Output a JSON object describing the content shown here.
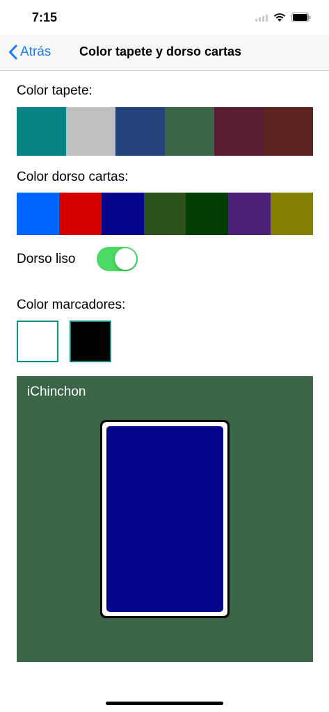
{
  "status_bar": {
    "time": "7:15",
    "icons": [
      "signal-icon",
      "wifi-icon",
      "battery-icon"
    ]
  },
  "navbar": {
    "back_label": "Atrás",
    "title": "Color tapete y dorso cartas"
  },
  "table_color": {
    "label": "Color tapete:",
    "colors": [
      "#088486",
      "#bfbfbf",
      "#23437a",
      "#3a6647",
      "#5a1e34",
      "#5f2422"
    ]
  },
  "card_back_color": {
    "label": "Color dorso cartas:",
    "colors": [
      "#0066ff",
      "#d40000",
      "#07058b",
      "#2c521c",
      "#003f01",
      "#4b2078",
      "#848000"
    ]
  },
  "plain_back": {
    "label": "Dorso liso",
    "on": true
  },
  "markers": {
    "label": "Color marcadores:",
    "colors": [
      "#ffffff",
      "#000000"
    ],
    "border_color": "#128a87"
  },
  "preview": {
    "label": "iChinchon",
    "table_color": "#3a6647",
    "card_back_color": "#07058b"
  }
}
